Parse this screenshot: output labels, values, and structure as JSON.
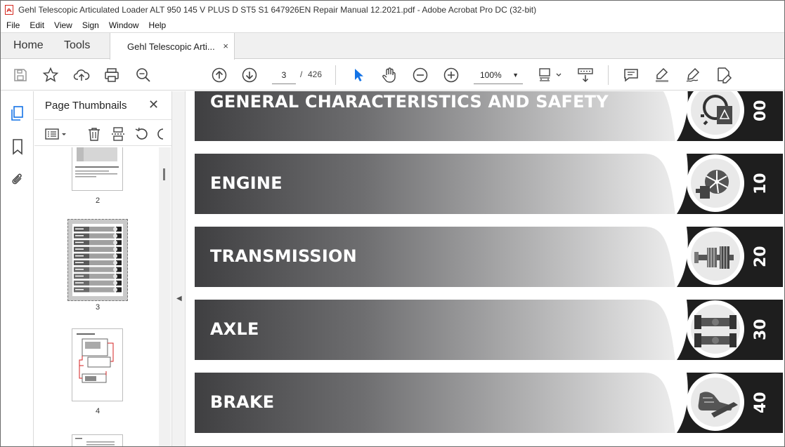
{
  "window": {
    "title": "Gehl Telescopic Articulated Loader ALT 950 145 V PLUS D ST5 S1 647926EN Repair Manual 12.2021.pdf - Adobe Acrobat Pro DC (32-bit)"
  },
  "menu": [
    "File",
    "Edit",
    "View",
    "Sign",
    "Window",
    "Help"
  ],
  "tabs": {
    "home": "Home",
    "tools": "Tools",
    "doc": "Gehl Telescopic Arti...",
    "doc_close": "×"
  },
  "toolbar": {
    "page_current": "3",
    "page_sep": "/",
    "page_total": "426",
    "zoom": "100%",
    "zoom_caret": "▼",
    "icons": [
      "save-icon",
      "star-icon",
      "upload-icon",
      "print-icon",
      "zoom-search-icon",
      "prev-page-icon",
      "next-page-icon",
      "select-arrow-icon",
      "hand-icon",
      "zoom-out-icon",
      "zoom-in-icon",
      "fit-page-icon",
      "scroll-mode-icon",
      "comment-icon",
      "highlight-icon",
      "sign-icon",
      "edit-pdf-icon"
    ]
  },
  "sidebar": {
    "title": "Page Thumbnails",
    "close": "✕",
    "thumbnails": [
      {
        "label": "2"
      },
      {
        "label": "3"
      },
      {
        "label": "4"
      }
    ]
  },
  "document": {
    "sections": [
      {
        "title": "GENERAL CHARACTERISTICS AND SAFETY",
        "code": "00",
        "icon": "safety-gear-icon"
      },
      {
        "title": "ENGINE",
        "code": "10",
        "icon": "engine-fan-icon"
      },
      {
        "title": "TRANSMISSION",
        "code": "20",
        "icon": "gearbox-shaft-icon"
      },
      {
        "title": "AXLE",
        "code": "30",
        "icon": "axle-icon"
      },
      {
        "title": "BRAKE",
        "code": "40",
        "icon": "brake-pedal-icon"
      }
    ]
  },
  "colors": {
    "accent": "#1473e6",
    "band_dark": "#3f3f41",
    "band_light": "#ececec",
    "badge": "#1e1e1e"
  }
}
